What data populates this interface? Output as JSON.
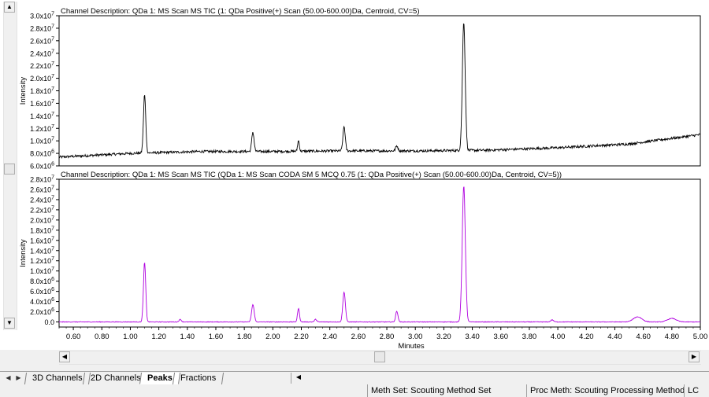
{
  "chart_data": [
    {
      "type": "line",
      "title": "Channel Description: QDa 1: MS Scan MS TIC (1: QDa Positive(+) Scan (50.00-600.00)Da, Centroid, CV=5)",
      "ylabel": "Intensity",
      "xlabel": "",
      "xlim": [
        0.5,
        5.0
      ],
      "ylim": [
        6000000,
        30000000
      ],
      "yticks": [
        {
          "value": 30000000,
          "mant": "3.0x10",
          "exp": "7"
        },
        {
          "value": 28000000,
          "mant": "2.8x10",
          "exp": "7"
        },
        {
          "value": 26000000,
          "mant": "2.6x10",
          "exp": "7"
        },
        {
          "value": 24000000,
          "mant": "2.4x10",
          "exp": "7"
        },
        {
          "value": 22000000,
          "mant": "2.2x10",
          "exp": "7"
        },
        {
          "value": 20000000,
          "mant": "2.0x10",
          "exp": "7"
        },
        {
          "value": 18000000,
          "mant": "1.8x10",
          "exp": "7"
        },
        {
          "value": 16000000,
          "mant": "1.6x10",
          "exp": "7"
        },
        {
          "value": 14000000,
          "mant": "1.4x10",
          "exp": "7"
        },
        {
          "value": 12000000,
          "mant": "1.2x10",
          "exp": "7"
        },
        {
          "value": 10000000,
          "mant": "1.0x10",
          "exp": "7"
        },
        {
          "value": 8000000,
          "mant": "8.0x10",
          "exp": "6"
        },
        {
          "value": 6000000,
          "mant": "6.0x10",
          "exp": "6"
        }
      ],
      "color": "#000000",
      "baseline": [
        [
          0.5,
          7400000
        ],
        [
          1.0,
          8000000
        ],
        [
          1.5,
          8300000
        ],
        [
          2.0,
          8300000
        ],
        [
          2.5,
          8400000
        ],
        [
          3.0,
          8400000
        ],
        [
          3.5,
          8500000
        ],
        [
          4.0,
          8900000
        ],
        [
          4.5,
          9500000
        ],
        [
          5.0,
          11000000
        ]
      ],
      "noise": 200000,
      "peaks": [
        {
          "x": 1.1,
          "height": 9300000,
          "width": 0.008
        },
        {
          "x": 1.86,
          "height": 3100000,
          "width": 0.008
        },
        {
          "x": 2.18,
          "height": 1700000,
          "width": 0.006
        },
        {
          "x": 2.5,
          "height": 3900000,
          "width": 0.008
        },
        {
          "x": 2.87,
          "height": 800000,
          "width": 0.008
        },
        {
          "x": 3.34,
          "height": 20500000,
          "width": 0.01
        }
      ]
    },
    {
      "type": "line",
      "title": "Channel Description: QDa 1: MS Scan MS TIC  (QDa 1: MS Scan CODA SM 5 MCQ 0.75  (1: QDa Positive(+) Scan (50.00-600.00)Da, Centroid, CV=5))",
      "ylabel": "Intensity",
      "xlabel": "Minutes",
      "xlim": [
        0.5,
        5.0
      ],
      "ylim": [
        -1000000,
        28000000
      ],
      "yticks": [
        {
          "value": 28000000,
          "mant": "2.8x10",
          "exp": "7"
        },
        {
          "value": 26000000,
          "mant": "2.6x10",
          "exp": "7"
        },
        {
          "value": 24000000,
          "mant": "2.4x10",
          "exp": "7"
        },
        {
          "value": 22000000,
          "mant": "2.2x10",
          "exp": "7"
        },
        {
          "value": 20000000,
          "mant": "2.0x10",
          "exp": "7"
        },
        {
          "value": 18000000,
          "mant": "1.8x10",
          "exp": "7"
        },
        {
          "value": 16000000,
          "mant": "1.6x10",
          "exp": "7"
        },
        {
          "value": 14000000,
          "mant": "1.4x10",
          "exp": "7"
        },
        {
          "value": 12000000,
          "mant": "1.2x10",
          "exp": "7"
        },
        {
          "value": 10000000,
          "mant": "1.0x10",
          "exp": "7"
        },
        {
          "value": 8000000,
          "mant": "8.0x10",
          "exp": "6"
        },
        {
          "value": 6000000,
          "mant": "6.0x10",
          "exp": "6"
        },
        {
          "value": 4000000,
          "mant": "4.0x10",
          "exp": "6"
        },
        {
          "value": 2000000,
          "mant": "2.0x10",
          "exp": "6"
        },
        {
          "value": 0,
          "mant": "0.0",
          "exp": ""
        }
      ],
      "xticks": [
        "0.60",
        "0.80",
        "1.00",
        "1.20",
        "1.40",
        "1.60",
        "1.80",
        "2.00",
        "2.20",
        "2.40",
        "2.60",
        "2.80",
        "3.00",
        "3.20",
        "3.40",
        "3.60",
        "3.80",
        "4.00",
        "4.20",
        "4.40",
        "4.60",
        "4.80",
        "5.00"
      ],
      "color": "#b000e0",
      "baseline": [
        [
          0.5,
          0
        ],
        [
          5.0,
          0
        ]
      ],
      "noise": 60000,
      "peaks": [
        {
          "x": 1.1,
          "height": 11700000,
          "width": 0.008
        },
        {
          "x": 1.35,
          "height": 500000,
          "width": 0.008
        },
        {
          "x": 1.86,
          "height": 3400000,
          "width": 0.009
        },
        {
          "x": 2.18,
          "height": 2600000,
          "width": 0.007
        },
        {
          "x": 2.3,
          "height": 500000,
          "width": 0.008
        },
        {
          "x": 2.5,
          "height": 5900000,
          "width": 0.009
        },
        {
          "x": 2.87,
          "height": 2100000,
          "width": 0.008
        },
        {
          "x": 3.34,
          "height": 26700000,
          "width": 0.011
        },
        {
          "x": 3.96,
          "height": 400000,
          "width": 0.01
        },
        {
          "x": 4.56,
          "height": 1000000,
          "width": 0.03
        },
        {
          "x": 4.8,
          "height": 700000,
          "width": 0.03
        }
      ]
    }
  ],
  "tabs": [
    {
      "label": "3D Channels",
      "active": false
    },
    {
      "label": "2D Channels",
      "active": false
    },
    {
      "label": "Peaks",
      "active": true
    },
    {
      "label": "Fractions",
      "active": false
    }
  ],
  "status": {
    "meth_set": "Meth Set: Scouting Method Set",
    "proc_meth": "Proc Meth: Scouting Processing Method",
    "mode": "LC"
  },
  "icons": {
    "scroll_up": "▲",
    "scroll_down": "▼",
    "scroll_left": "◀",
    "scroll_right": "▶",
    "tab_prev": "◀",
    "tab_next": "▶"
  }
}
